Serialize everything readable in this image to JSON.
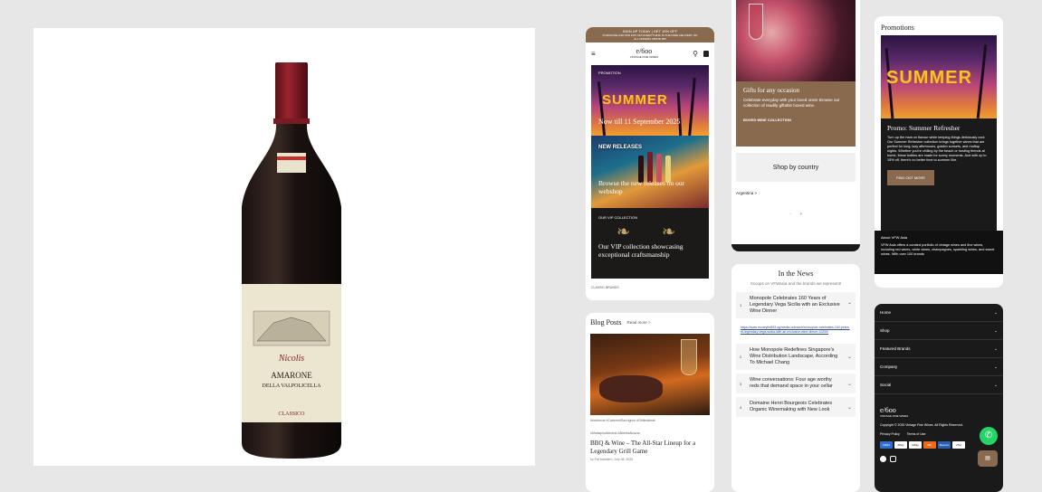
{
  "product": {
    "brand": "Nicolis",
    "name_line1": "AMARONE",
    "name_line2": "DELLA VALPOLICELLA",
    "name_line3": "CLASSICO"
  },
  "phone1": {
    "announce_line1": "SIGN UP TODAY | GET 10% OFF",
    "announce_line2": "PURCHASE AND WIN 10% OFF EVERYTHING IN THE FREE DELIVERY ON",
    "announce_line3": "ALL ORDERS ABOVE $50",
    "logo": "e/6oo",
    "logo_sub": "VINTAGE FINE WINES",
    "tile1_label": "PROMOTION",
    "tile1_word": "SUMMER",
    "tile1_caption": "Now till 11 September 2025",
    "tile2_word": "NEW RELEASES",
    "tile2_caption": "Browse the new releases on our webshop",
    "tile3_label": "OUR VIP COLLECTION",
    "tile3_caption": "Our VIP collection showcasing exceptional craftsmanship",
    "bottom_label": "CLASSIC BRANDS"
  },
  "phone2": {
    "title": "Blog Posts",
    "read_more": "Read more >",
    "tags1": "#barbecue  #CabernetSauvignon  #Grilledsteak",
    "tags2": "#MalaspinaNeutral  #AlbertaAlcazar",
    "post_title": "BBQ & Wine – The All-Star Lineup for a Legendary Grill Game",
    "byline": "by Pat Madden  |  July 08, 2025"
  },
  "phone3": {
    "gift_title": "Gifts for any occasion",
    "gift_body": "Celebrate everyday with your loved ones! Browse our collection of readily giftable boxed wine.",
    "gift_cta": "BOXED WINE COLLECTION",
    "shop_country": "Shop by country",
    "country": "Argentina >"
  },
  "phone4": {
    "title": "In the News",
    "subtitle": "Scoops on VFWasia and the brands we represent!",
    "items": [
      {
        "num": "1",
        "title": "Monopole Celebrates 160 Years of Legendary Vega Sicilia with an Exclusive Wine Dinner",
        "chev": "^"
      },
      {
        "num": "2",
        "title": "How Monopole Redefines Singapore's Wine Distribution Landscape, According To Michael Chang",
        "chev": "v"
      },
      {
        "num": "3",
        "title": "Wine conversations: Four age worthy reds that demand space in your cellar",
        "chev": "v"
      },
      {
        "num": "4",
        "title": "Domaine Henri Bourgeois Celebrates Organic Winemaking with New Look",
        "chev": "v"
      }
    ],
    "link": "https://www.moneyfm893.sg/media-outreach/monopole-celebrates-160-years-of-legendary-vega-sicilia-with-an-exclusive-wine-dinner-10200/"
  },
  "phone5": {
    "title": "Promotions",
    "summer_word": "SUMMER",
    "promo_title": "Promo: Summer Refresher",
    "promo_body": "Turn up the heat on flavour while keeping things deliciously cool. Our Summer Refresher collection brings together wines that are perfect for long, lazy afternoons, golden sunsets, and rooftop nights. Whether you're chilling by the beach or hosting friends at home, these bottles are made for sunny moments. And with up to 15% off, there's no better time to summer like.",
    "cta": "FIND OUT MORE",
    "about_title": "About VFW Asia",
    "about_body": "VFW Asia offers a curated portfolio of vintage wines and fine wines, including red wines, white wines, champagnes, sparkling wines, and sweet wines. With over 100 brands"
  },
  "phone6": {
    "menu": [
      "Home",
      "Shop",
      "Featured Brands",
      "Company",
      "Social"
    ],
    "logo": "e/6oo",
    "logo_sub": "VINTAGE FINE WINES",
    "copyright": "Copyright © 2025 Vintage Fine Wines. All Rights Reserved.",
    "privacy": "Privacy Policy",
    "terms": "Terms of Use",
    "payments": [
      "AMEX",
      "APay",
      "GPay",
      "MC",
      "Maestro",
      "VISA"
    ]
  },
  "colors": {
    "brand_brown": "#8a6a4f",
    "footer_dark": "#1a1a1a",
    "whatsapp": "#25d366"
  }
}
